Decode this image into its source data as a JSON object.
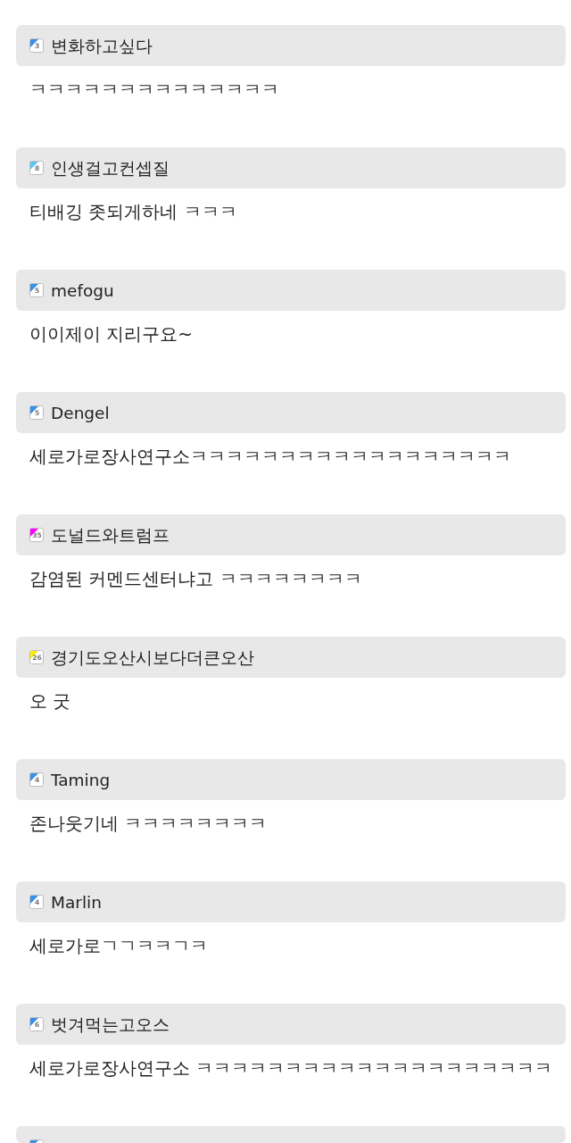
{
  "comments": [
    {
      "grade": "3",
      "color": "#3d8ee6",
      "username": "변화하고싶다",
      "text": "ㅋㅋㅋㅋㅋㅋㅋㅋㅋㅋㅋㅋㅋㅋ"
    },
    {
      "grade": "8",
      "color": "#5ec4f5",
      "username": "인생걸고컨셉질",
      "text": "티배깅 좃되게하네 ㅋㅋㅋ"
    },
    {
      "grade": "5",
      "color": "#3d8ee6",
      "username": "mefogu",
      "text": "이이제이 지리구요~"
    },
    {
      "grade": "5",
      "color": "#3d8ee6",
      "username": "Dengel",
      "text": "세로가로장사연구소ㅋㅋㅋㅋㅋㅋㅋㅋㅋㅋㅋㅋㅋㅋㅋㅋㅋㅋ"
    },
    {
      "grade": "35",
      "color": "#ff00ff",
      "username": "도널드와트럼프",
      "text": "감염된 커멘드센터냐고 ㅋㅋㅋㅋㅋㅋㅋㅋ"
    },
    {
      "grade": "26",
      "color": "#ffee00",
      "username": "경기도오산시보다더큰오산",
      "text": "오 굿"
    },
    {
      "grade": "4",
      "color": "#3d8ee6",
      "username": "Taming",
      "text": "존나웃기네 ㅋㅋㅋㅋㅋㅋㅋㅋ"
    },
    {
      "grade": "4",
      "color": "#3d8ee6",
      "username": "Marlin",
      "text": "세로가로ㄱㄱㅋㅋㄱㅋ"
    },
    {
      "grade": "6",
      "color": "#3d8ee6",
      "username": "벗겨먹는고오스",
      "text": "세로가로장사연구소 ㅋㅋㅋㅋㅋㅋㅋㅋㅋㅋㅋㅋㅋㅋㅋㅋㅋㅋㅋㅋ"
    },
    {
      "color": "#3d8ee6"
    }
  ]
}
